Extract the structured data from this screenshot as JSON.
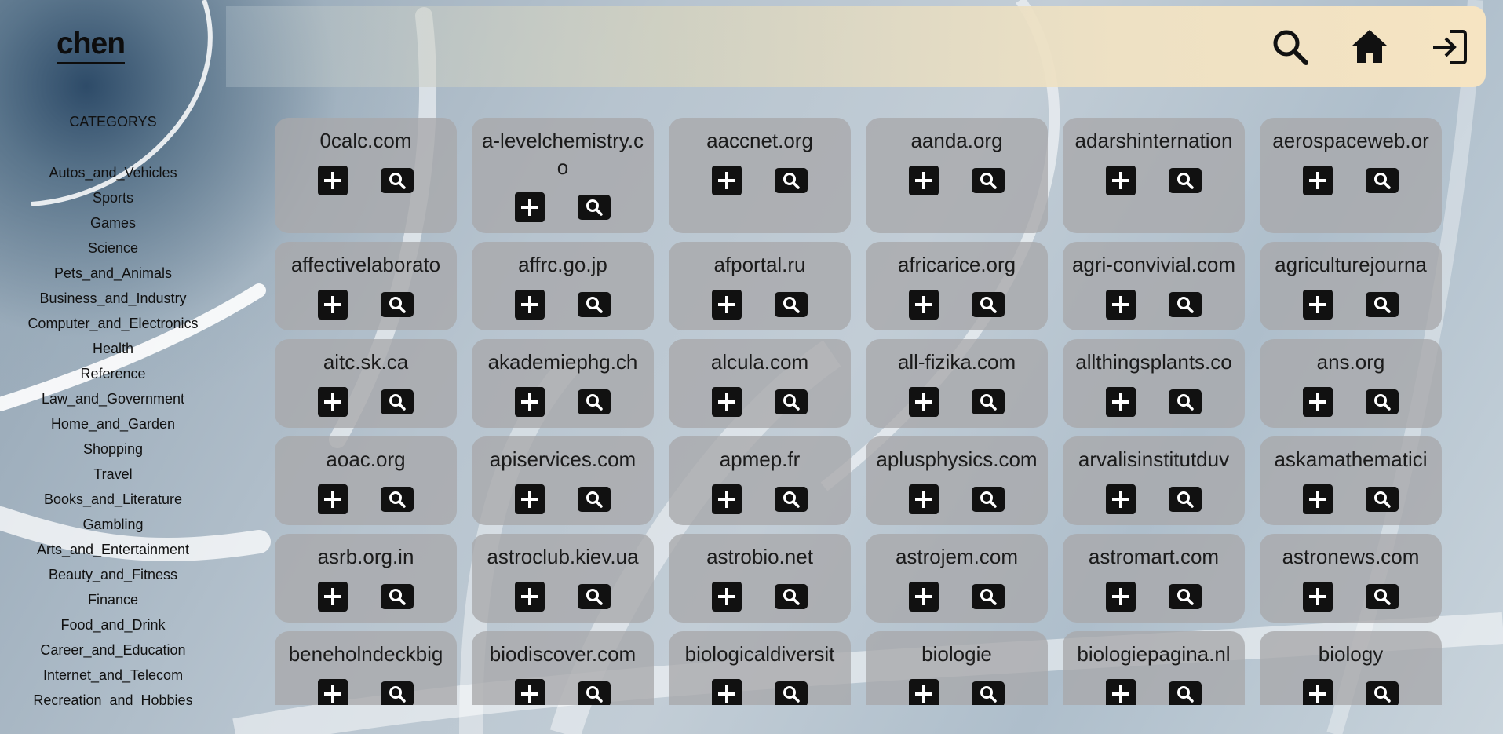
{
  "app": {
    "logo": "chen"
  },
  "sidebar": {
    "heading": "CATEGORYS",
    "categories": [
      "Autos_and_Vehicles",
      "Sports",
      "Games",
      "Science",
      "Pets_and_Animals",
      "Business_and_Industry",
      "Computer_and_Electronics",
      "Health",
      "Reference",
      "Law_and_Government",
      "Home_and_Garden",
      "Shopping",
      "Travel",
      "Books_and_Literature",
      "Gambling",
      "Arts_and_Entertainment",
      "Beauty_and_Fitness",
      "Finance",
      "Food_and_Drink",
      "Career_and_Education",
      "Internet_and_Telecom",
      "Recreation_and_Hobbies"
    ]
  },
  "topbar": {
    "icons": [
      "search-icon",
      "home-icon",
      "logout-icon"
    ]
  },
  "sites": [
    "0calc.com",
    "a-levelchemistry.co",
    "aaccnet.org",
    "aanda.org",
    "adarshinternation",
    "aerospaceweb.or",
    "affectivelaborato",
    "affrc.go.jp",
    "afportal.ru",
    "africarice.org",
    "agri-convivial.com",
    "agriculturejourna",
    "aitc.sk.ca",
    "akademiephg.ch",
    "alcula.com",
    "all-fizika.com",
    "allthingsplants.co",
    "ans.org",
    "aoac.org",
    "apiservices.com",
    "apmep.fr",
    "aplusphysics.com",
    "arvalisinstitutduv",
    "askamathematici",
    "asrb.org.in",
    "astroclub.kiev.ua",
    "astrobio.net",
    "astrojem.com",
    "astromart.com",
    "astronews.com",
    "beneholndeckbig",
    "biodiscover.com",
    "biologicaldiversit",
    "biologie",
    "biologiepagina.nl",
    "biology"
  ],
  "colors": {
    "card_bg": "#a8a8aa",
    "button_bg": "#111111",
    "topbar_end": "#f6e4c2"
  }
}
